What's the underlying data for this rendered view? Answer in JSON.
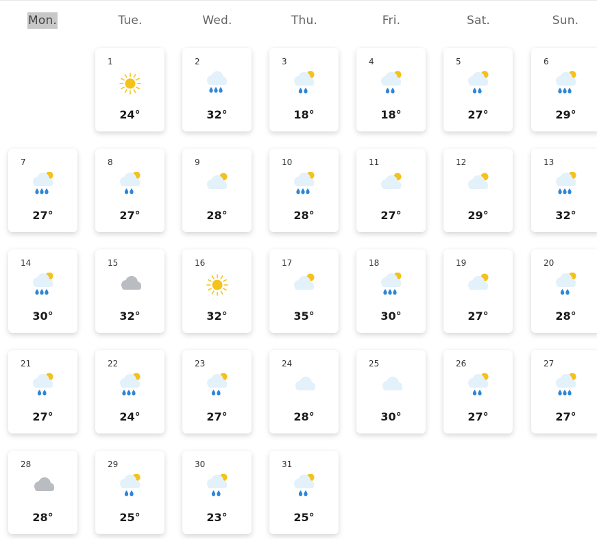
{
  "weekdays": [
    "Mon.",
    "Tue.",
    "Wed.",
    "Thu.",
    "Fri.",
    "Sat.",
    "Sun."
  ],
  "active_weekday": "Mon.",
  "month_start_column": 1,
  "colors": {
    "sun": "#f5c21b",
    "cloud_light": "#e3f1fb",
    "cloud_grey": "#b9bdc1",
    "rain_drop": "#2f86d6"
  },
  "days": [
    {
      "day": "1",
      "temp": "24°",
      "icon": "sun-icon"
    },
    {
      "day": "2",
      "temp": "32°",
      "icon": "cloud-rain-icon"
    },
    {
      "day": "3",
      "temp": "18°",
      "icon": "sun-cloud-rain-2-icon"
    },
    {
      "day": "4",
      "temp": "18°",
      "icon": "sun-cloud-rain-2-icon"
    },
    {
      "day": "5",
      "temp": "27°",
      "icon": "sun-cloud-rain-2-icon"
    },
    {
      "day": "6",
      "temp": "29°",
      "icon": "sun-cloud-rain-3-icon"
    },
    {
      "day": "7",
      "temp": "27°",
      "icon": "sun-cloud-rain-3-icon"
    },
    {
      "day": "8",
      "temp": "27°",
      "icon": "sun-cloud-rain-2-icon"
    },
    {
      "day": "9",
      "temp": "28°",
      "icon": "sun-cloud-icon"
    },
    {
      "day": "10",
      "temp": "28°",
      "icon": "sun-cloud-rain-3-icon"
    },
    {
      "day": "11",
      "temp": "27°",
      "icon": "sun-cloud-icon"
    },
    {
      "day": "12",
      "temp": "29°",
      "icon": "sun-cloud-icon"
    },
    {
      "day": "13",
      "temp": "32°",
      "icon": "sun-cloud-rain-3-icon"
    },
    {
      "day": "14",
      "temp": "30°",
      "icon": "sun-cloud-rain-3-icon"
    },
    {
      "day": "15",
      "temp": "32°",
      "icon": "grey-cloud-icon"
    },
    {
      "day": "16",
      "temp": "32°",
      "icon": "sun-icon"
    },
    {
      "day": "17",
      "temp": "35°",
      "icon": "sun-cloud-icon"
    },
    {
      "day": "18",
      "temp": "30°",
      "icon": "sun-cloud-rain-3-icon"
    },
    {
      "day": "19",
      "temp": "27°",
      "icon": "sun-cloud-icon"
    },
    {
      "day": "20",
      "temp": "28°",
      "icon": "sun-cloud-rain-2-icon"
    },
    {
      "day": "21",
      "temp": "27°",
      "icon": "sun-cloud-rain-2-icon"
    },
    {
      "day": "22",
      "temp": "24°",
      "icon": "sun-cloud-rain-3-icon"
    },
    {
      "day": "23",
      "temp": "27°",
      "icon": "sun-cloud-rain-2-icon"
    },
    {
      "day": "24",
      "temp": "28°",
      "icon": "cloud-icon"
    },
    {
      "day": "25",
      "temp": "30°",
      "icon": "cloud-icon"
    },
    {
      "day": "26",
      "temp": "27°",
      "icon": "sun-cloud-rain-2-icon"
    },
    {
      "day": "27",
      "temp": "27°",
      "icon": "sun-cloud-rain-3-icon"
    },
    {
      "day": "28",
      "temp": "28°",
      "icon": "grey-cloud-icon"
    },
    {
      "day": "29",
      "temp": "25°",
      "icon": "sun-cloud-rain-2-icon"
    },
    {
      "day": "30",
      "temp": "23°",
      "icon": "sun-cloud-rain-2-icon"
    },
    {
      "day": "31",
      "temp": "25°",
      "icon": "sun-cloud-rain-2-icon"
    }
  ]
}
